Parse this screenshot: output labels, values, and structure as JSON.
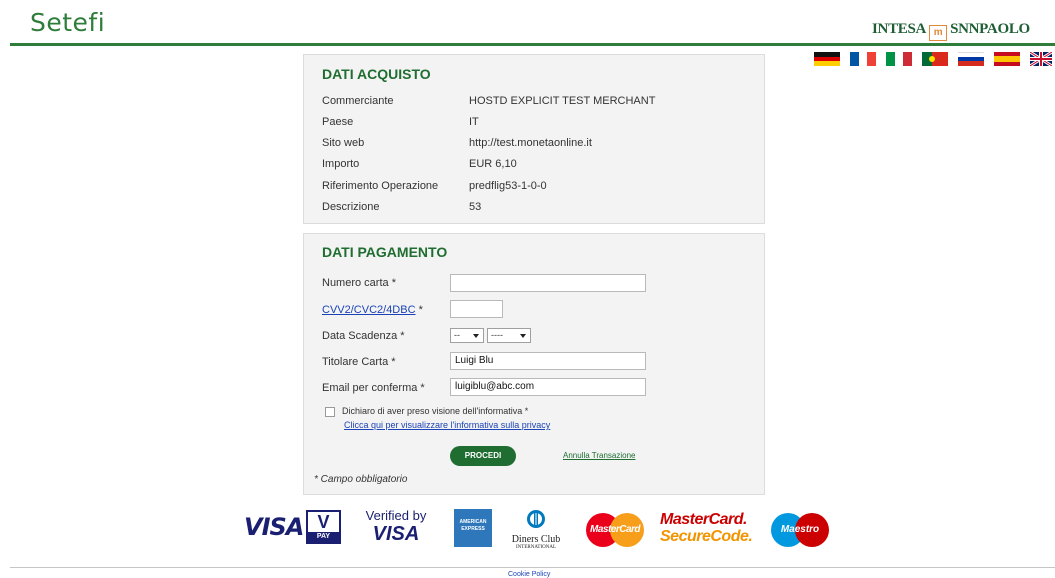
{
  "header": {
    "brand": "Setefi",
    "bank_name_left": "INTESA",
    "bank_mark": "m",
    "bank_name_right": "SNNPAOLO"
  },
  "languages": [
    {
      "code": "de",
      "icon": "flag-germany"
    },
    {
      "code": "fr",
      "icon": "flag-france"
    },
    {
      "code": "it",
      "icon": "flag-italy"
    },
    {
      "code": "pt",
      "icon": "flag-portugal"
    },
    {
      "code": "ru",
      "icon": "flag-russia"
    },
    {
      "code": "es",
      "icon": "flag-spain"
    },
    {
      "code": "en",
      "icon": "flag-uk"
    }
  ],
  "purchase": {
    "title": "DATI ACQUISTO",
    "rows": [
      {
        "label": "Commerciante",
        "value": "HOSTD EXPLICIT TEST MERCHANT"
      },
      {
        "label": "Paese",
        "value": "IT"
      },
      {
        "label": "Sito web",
        "value": "http://test.monetaonline.it"
      },
      {
        "label": "Importo",
        "value": "EUR 6,10"
      },
      {
        "label": "Riferimento Operazione",
        "value": "predflig53-1-0-0"
      },
      {
        "label": "Descrizione",
        "value": "53"
      }
    ]
  },
  "payment": {
    "title": "DATI PAGAMENTO",
    "card_number_label": "Numero carta *",
    "card_number_value": "",
    "cvv_link": "CVV2/CVC2/4DBC",
    "cvv_required": " *",
    "cvv_value": "",
    "expiry_label": "Data Scadenza *",
    "expiry_month": "--",
    "expiry_year": "----",
    "holder_label": "Titolare Carta *",
    "holder_value": "Luigi Blu",
    "email_label": "Email per conferma *",
    "email_value": "luigiblu@abc.com",
    "consent_text": "Dichiaro di aver preso visione dell'informativa *",
    "privacy_link": "Clicca qui per visualizzare l'informativa sulla privacy",
    "submit_label": "PROCEDI",
    "cancel_label": "Annulla Transazione",
    "required_note": "* Campo obbligatorio"
  },
  "card_logos": [
    {
      "icon": "visa-logo",
      "text": "VISA"
    },
    {
      "icon": "v-pay-logo",
      "text_top": "V",
      "text_bottom": "PAY"
    },
    {
      "icon": "verified-by-visa-logo",
      "text_top": "Verified by",
      "text_bottom": "VISA"
    },
    {
      "icon": "american-express-logo",
      "text_top": "AMERICAN",
      "text_bottom": "EXPRESS"
    },
    {
      "icon": "diners-club-logo",
      "text_top": "Diners Club",
      "text_bottom": "INTERNATIONAL"
    },
    {
      "icon": "mastercard-logo",
      "text": "MasterCard"
    },
    {
      "icon": "mastercard-securecode-logo",
      "text_top": "MasterCard.",
      "text_bottom": "SecureCode."
    },
    {
      "icon": "maestro-logo",
      "text": "Maestro"
    }
  ],
  "footer": {
    "cookie_policy": "Cookie Policy"
  },
  "colors": {
    "brand_green": "#2e7d3b",
    "title_green": "#1f6d31",
    "link_blue": "#1c44b6",
    "panel_bg": "#f3f3f3"
  }
}
